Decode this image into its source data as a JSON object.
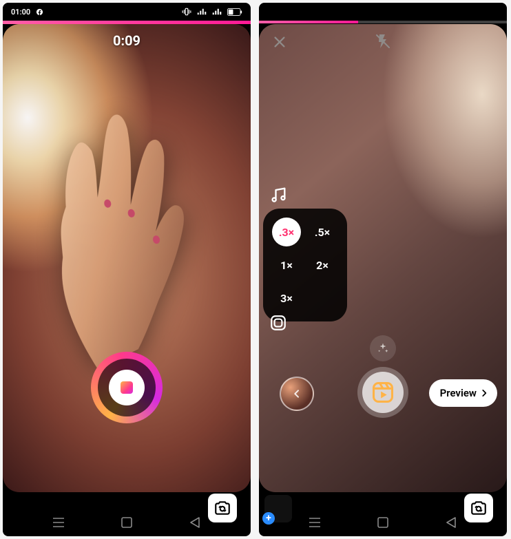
{
  "left": {
    "status": {
      "time": "01:00"
    },
    "timer": "0:09"
  },
  "right": {
    "speed": {
      "options": [
        ".3×",
        ".5×",
        "1×",
        "2×",
        "3×"
      ],
      "active": ".3×"
    },
    "preview_label": "Preview"
  }
}
